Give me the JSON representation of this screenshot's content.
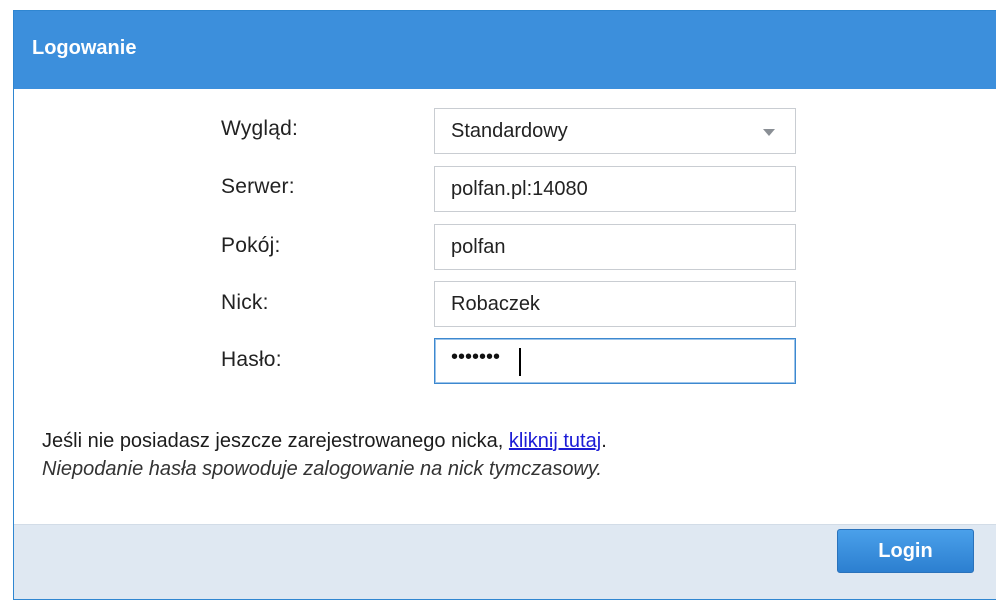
{
  "dialog": {
    "title": "Logowanie"
  },
  "form": {
    "wyglad_label": "Wygląd:",
    "wyglad_value": "Standardowy",
    "serwer_label": "Serwer:",
    "serwer_value": "polfan.pl:14080",
    "pokoj_label": "Pokój:",
    "pokoj_value": "polfan",
    "nick_label": "Nick:",
    "nick_value": "Robaczek",
    "haslo_label": "Hasło:",
    "haslo_masked": "•••••••"
  },
  "info": {
    "register_text": "Jeśli nie posiadasz jeszcze zarejestrowanego nicka,",
    "register_link": "kliknij tutaj",
    "register_suffix": ".",
    "temp_note": "Niepodanie hasła spowoduje zalogowanie na nick tymczasowy."
  },
  "footer": {
    "login_label": "Login"
  },
  "colors": {
    "titlebar": "#3c8fdc",
    "footer": "#dfe8f2",
    "link": "#1b1bd6",
    "button": "#3a8fe0"
  },
  "icons": {
    "select_arrow": "chevron-down-icon"
  }
}
